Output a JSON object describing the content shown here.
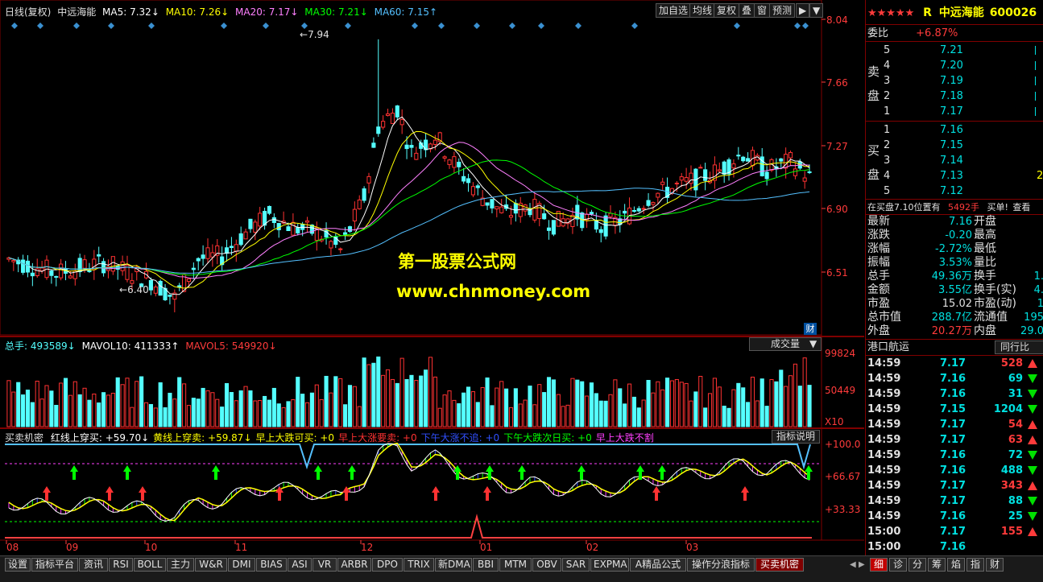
{
  "main_chart": {
    "header": {
      "period": "日线(复权)",
      "stock": "中远海能",
      "ma5": "MA5: 7.32↓",
      "ma10": "MA10: 7.26↓",
      "ma20": "MA20: 7.17↓",
      "ma30": "MA30: 7.21↓",
      "ma60": "MA60: 7.15↑"
    },
    "toolbar": [
      "加自选",
      "均线",
      "复权",
      "叠",
      "窗",
      "预测",
      "▶",
      "▼"
    ],
    "y_ticks": [
      "8.04",
      "7.66",
      "7.27",
      "6.90",
      "6.51"
    ],
    "high_label": "7.94",
    "low_label": "6.40",
    "watermark_title": "第一股票公式网",
    "watermark_url": "www.chnmoney.com",
    "fin_icon": "财",
    "colors": {
      "up": "#ff3232",
      "down": "#54ffff",
      "ma5": "#ffffff",
      "ma10": "#ffff00",
      "ma20": "#ff80ff",
      "ma30": "#00ff00",
      "ma60": "#54c0ff"
    }
  },
  "volume_chart": {
    "legend_total": "总手: 493589↓",
    "legend_mavol10": "MAVOL10: 411333↑",
    "legend_mavol5": "MAVOL5: 549920↓",
    "selector": "成交量",
    "y_ticks": [
      "99824",
      "50449"
    ],
    "unit": "X10"
  },
  "indicator_chart": {
    "name": "买卖机密",
    "items": [
      {
        "text": "红线上穿买: +59.70↓",
        "color": "#ffffff"
      },
      {
        "text": "黄线上穿卖: +59.87↓",
        "color": "#ffff00"
      },
      {
        "text": "早上大跌可买: +0",
        "color": "#ffff00"
      },
      {
        "text": "早上大涨要卖: +0",
        "color": "#ff3232"
      },
      {
        "text": "下午大涨不追: +0",
        "color": "#3050ff"
      },
      {
        "text": "下午大跌次日买: +0",
        "color": "#00ff00"
      },
      {
        "text": "早上大跌不割",
        "color": "#ff40ff"
      }
    ],
    "help_button": "指标说明",
    "y_ticks": [
      "+100.0",
      "+66.67",
      "+33.33"
    ]
  },
  "x_axis": {
    "labels": [
      "08",
      "09",
      "10",
      "11",
      "12",
      "01",
      "02",
      "03"
    ]
  },
  "right_panel": {
    "stars": "★★★★★",
    "flag": "R",
    "name": "中远海能",
    "code": "600026",
    "weibi_label": "委比",
    "weibi_value": "+6.87%",
    "sell_label": "卖盘",
    "buy_label": "买盘",
    "sell": [
      {
        "level": "5",
        "price": "7.21"
      },
      {
        "level": "4",
        "price": "7.20"
      },
      {
        "level": "3",
        "price": "7.19"
      },
      {
        "level": "2",
        "price": "7.18"
      },
      {
        "level": "1",
        "price": "7.17"
      }
    ],
    "buy": [
      {
        "level": "1",
        "price": "7.16"
      },
      {
        "level": "2",
        "price": "7.15"
      },
      {
        "level": "3",
        "price": "7.14"
      },
      {
        "level": "4",
        "price": "7.13",
        "vol": "2"
      },
      {
        "level": "5",
        "price": "7.12"
      }
    ],
    "notice_text": "在买盘7.10位置有",
    "notice_vol": "5492手",
    "notice_buy": "买单!",
    "notice_view": "查看",
    "quote": [
      {
        "l1": "最新",
        "v1": "7.16",
        "c1": "#00e0e0",
        "l2": "开盘",
        "v2": ""
      },
      {
        "l1": "涨跌",
        "v1": "-0.20",
        "c1": "#00e0e0",
        "l2": "最高",
        "v2": ""
      },
      {
        "l1": "涨幅",
        "v1": "-2.72%",
        "c1": "#00e0e0",
        "l2": "最低",
        "v2": ""
      },
      {
        "l1": "振幅",
        "v1": "3.53%",
        "c1": "#00e0e0",
        "l2": "量比",
        "v2": ""
      },
      {
        "l1": "总手",
        "v1": "49.36万",
        "c1": "#00e0e0",
        "l2": "换手",
        "v2": "1."
      },
      {
        "l1": "金额",
        "v1": "3.55亿",
        "c1": "#00e0e0",
        "l2": "换手(实)",
        "v2": "4."
      },
      {
        "l1": "市盈",
        "v1": "15.02",
        "c1": "#e0e0e0",
        "l2": "市盈(动)",
        "v2": "1"
      },
      {
        "l1": "总市值",
        "v1": "288.7亿",
        "c1": "#00e0e0",
        "l2": "流通值",
        "v2": "195"
      },
      {
        "l1": "外盘",
        "v1": "20.27万",
        "c1": "#ff3b3b",
        "l2": "内盘",
        "v2": "29.0"
      }
    ],
    "sector_name": "港口航运",
    "industry_button": "同行比",
    "ticks": [
      {
        "time": "14:59",
        "price": "7.17",
        "vol": "528",
        "dir": "up"
      },
      {
        "time": "14:59",
        "price": "7.16",
        "vol": "69",
        "dir": "down"
      },
      {
        "time": "14:59",
        "price": "7.16",
        "vol": "31",
        "dir": "down"
      },
      {
        "time": "14:59",
        "price": "7.15",
        "vol": "1204",
        "dir": "down"
      },
      {
        "time": "14:59",
        "price": "7.17",
        "vol": "54",
        "dir": "up"
      },
      {
        "time": "14:59",
        "price": "7.17",
        "vol": "63",
        "dir": "up"
      },
      {
        "time": "14:59",
        "price": "7.16",
        "vol": "72",
        "dir": "down"
      },
      {
        "time": "14:59",
        "price": "7.16",
        "vol": "488",
        "dir": "down"
      },
      {
        "time": "14:59",
        "price": "7.17",
        "vol": "343",
        "dir": "up"
      },
      {
        "time": "14:59",
        "price": "7.17",
        "vol": "88",
        "dir": "down"
      },
      {
        "time": "14:59",
        "price": "7.16",
        "vol": "25",
        "dir": "down"
      },
      {
        "time": "15:00",
        "price": "7.17",
        "vol": "155",
        "dir": "up"
      },
      {
        "time": "15:00",
        "price": "7.16",
        "vol": "",
        "dir": ""
      }
    ]
  },
  "bottom_tabs": [
    "设置",
    "指标平台",
    "资讯",
    "RSI",
    "BOLL",
    "主力",
    "W&R",
    "DMI",
    "BIAS",
    "ASI",
    "VR",
    "ARBR",
    "DPO",
    "TRIX",
    "新DMA",
    "BBI",
    "MTM",
    "OBV",
    "SAR",
    "EXPMA",
    "A精品公式",
    "操作分浪指标",
    "买卖机密"
  ],
  "active_tab": "买卖机密",
  "right_tabs": [
    "细",
    "诊",
    "分",
    "筹",
    "焰",
    "指",
    "财"
  ],
  "active_right_tab": "细"
}
